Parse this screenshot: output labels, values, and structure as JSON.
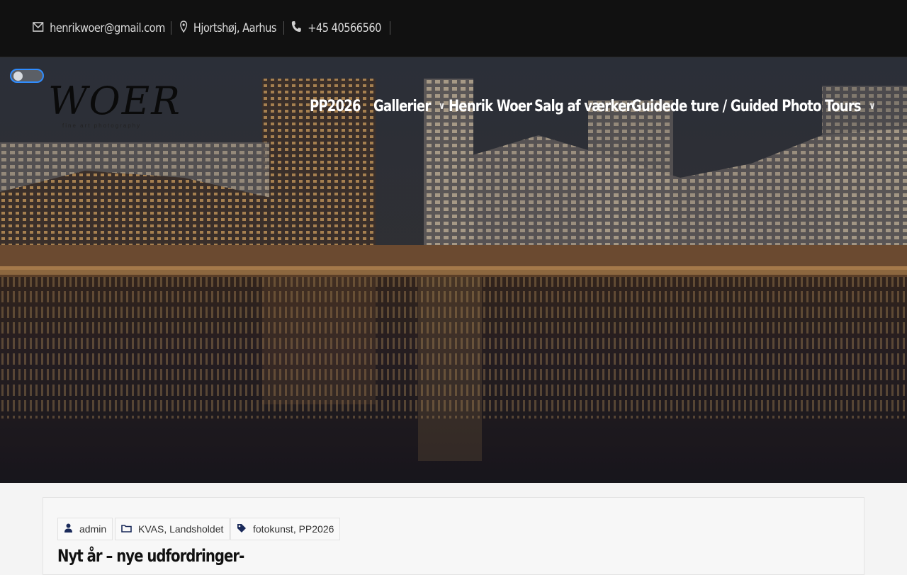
{
  "topbar": {
    "email": "henrikwoer@gmail.com",
    "location": "Hjortshøj, Aarhus",
    "phone": "+45 40566560",
    "icons": {
      "email": "mail-icon",
      "location": "map-pin-icon",
      "phone": "phone-icon"
    }
  },
  "header": {
    "logo_text": "WOER",
    "logo_sub": "fine art photography",
    "nav": [
      {
        "label": "PP2026",
        "has_submenu": false
      },
      {
        "label": "Gallerier",
        "has_submenu": true
      },
      {
        "label": "Henrik Woer",
        "has_submenu": false
      },
      {
        "label": "Salg af værker",
        "has_submenu": false
      },
      {
        "label": "Guidede ture / Guided Photo Tours",
        "has_submenu": true
      }
    ]
  },
  "post": {
    "author": "admin",
    "categories": "KVAS, Landsholdet",
    "tags": "fotokunst, PP2026",
    "title": "Nyt år – nye udfordringer-"
  },
  "colors": {
    "topbar": "#111111",
    "accent": "#2f8cff",
    "meta_icon": "#1a2a5a"
  }
}
